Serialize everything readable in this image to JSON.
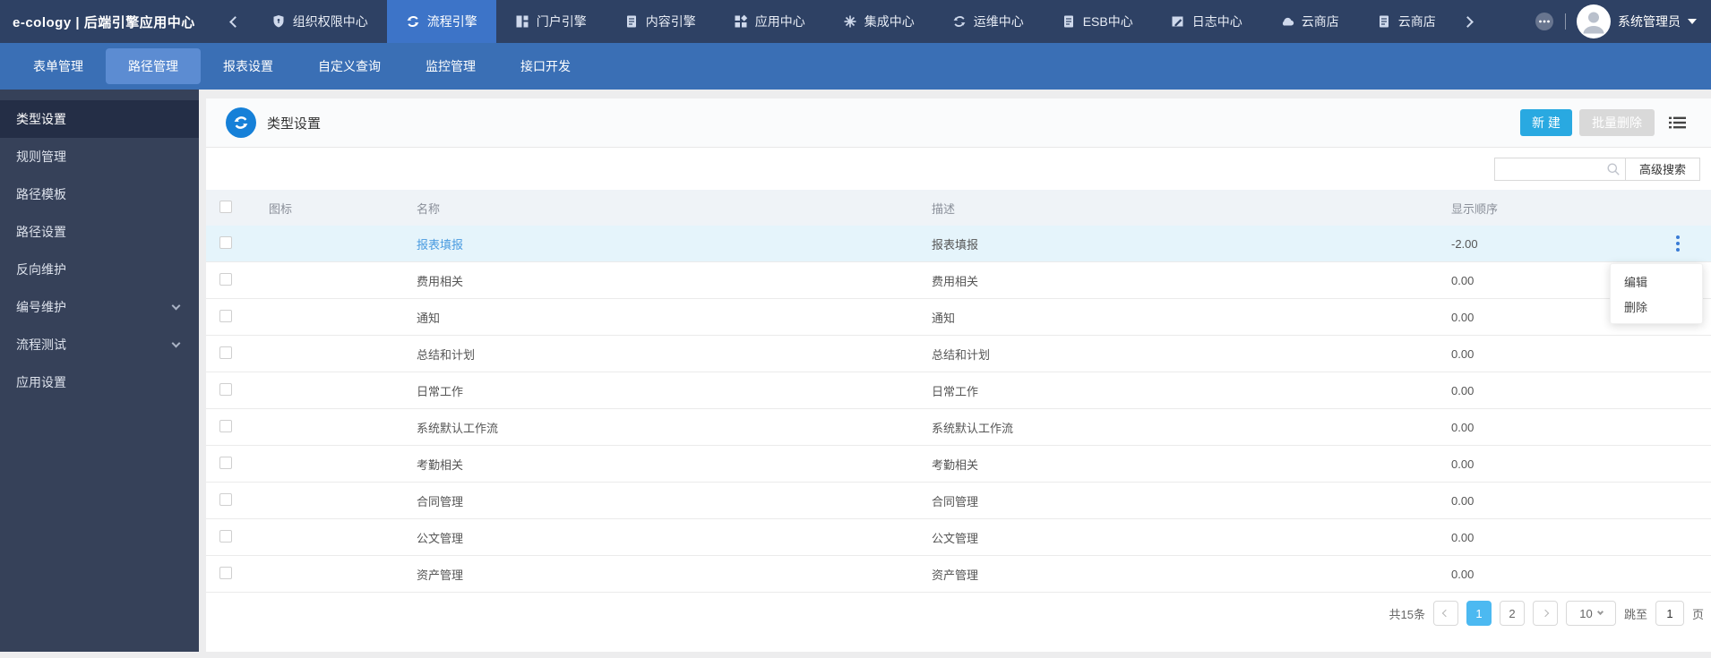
{
  "topbar": {
    "title": "e-cology | 后端引擎应用中心",
    "items": [
      {
        "label": "组织权限中心",
        "icon": "shield-icon",
        "active": false
      },
      {
        "label": "流程引擎",
        "icon": "flow-icon",
        "active": true
      },
      {
        "label": "门户引擎",
        "icon": "portal-icon",
        "active": false
      },
      {
        "label": "内容引擎",
        "icon": "document-icon",
        "active": false
      },
      {
        "label": "应用中心",
        "icon": "apps-icon",
        "active": false
      },
      {
        "label": "集成中心",
        "icon": "integration-icon",
        "active": false
      },
      {
        "label": "运维中心",
        "icon": "sync-icon",
        "active": false
      },
      {
        "label": "ESB中心",
        "icon": "document-icon",
        "active": false
      },
      {
        "label": "日志中心",
        "icon": "log-icon",
        "active": false
      },
      {
        "label": "云商店",
        "icon": "cloud-icon",
        "active": false
      },
      {
        "label": "云商店",
        "icon": "document-icon",
        "active": false
      }
    ],
    "user": {
      "name": "系统管理员"
    }
  },
  "subnav": {
    "items": [
      {
        "label": "表单管理",
        "active": false
      },
      {
        "label": "路径管理",
        "active": true
      },
      {
        "label": "报表设置",
        "active": false
      },
      {
        "label": "自定义查询",
        "active": false
      },
      {
        "label": "监控管理",
        "active": false
      },
      {
        "label": "接口开发",
        "active": false
      }
    ]
  },
  "sidebar": {
    "items": [
      {
        "label": "类型设置",
        "active": true,
        "expandable": false
      },
      {
        "label": "规则管理",
        "active": false,
        "expandable": false
      },
      {
        "label": "路径模板",
        "active": false,
        "expandable": false
      },
      {
        "label": "路径设置",
        "active": false,
        "expandable": false
      },
      {
        "label": "反向维护",
        "active": false,
        "expandable": false
      },
      {
        "label": "编号维护",
        "active": false,
        "expandable": true
      },
      {
        "label": "流程测试",
        "active": false,
        "expandable": true
      },
      {
        "label": "应用设置",
        "active": false,
        "expandable": false
      }
    ]
  },
  "panel": {
    "title": "类型设置",
    "new_button": "新 建",
    "batch_delete_button": "批量删除",
    "advanced_search_button": "高级搜索",
    "search_value": "",
    "table": {
      "columns": [
        "图标",
        "名称",
        "描述",
        "显示顺序"
      ],
      "rows": [
        {
          "icon": "",
          "name": "报表填报",
          "desc": "报表填报",
          "order": "-2.00",
          "highlighted": true
        },
        {
          "icon": "",
          "name": "费用相关",
          "desc": "费用相关",
          "order": "0.00",
          "highlighted": false
        },
        {
          "icon": "",
          "name": "通知",
          "desc": "通知",
          "order": "0.00",
          "highlighted": false
        },
        {
          "icon": "",
          "name": "总结和计划",
          "desc": "总结和计划",
          "order": "0.00",
          "highlighted": false
        },
        {
          "icon": "",
          "name": "日常工作",
          "desc": "日常工作",
          "order": "0.00",
          "highlighted": false
        },
        {
          "icon": "",
          "name": "系统默认工作流",
          "desc": "系统默认工作流",
          "order": "0.00",
          "highlighted": false
        },
        {
          "icon": "",
          "name": "考勤相关",
          "desc": "考勤相关",
          "order": "0.00",
          "highlighted": false
        },
        {
          "icon": "",
          "name": "合同管理",
          "desc": "合同管理",
          "order": "0.00",
          "highlighted": false
        },
        {
          "icon": "",
          "name": "公文管理",
          "desc": "公文管理",
          "order": "0.00",
          "highlighted": false
        },
        {
          "icon": "",
          "name": "资产管理",
          "desc": "资产管理",
          "order": "0.00",
          "highlighted": false
        }
      ]
    },
    "row_menu": {
      "items": [
        "编辑",
        "删除"
      ]
    },
    "pagination": {
      "total": "共15条",
      "pages": [
        "1",
        "2"
      ],
      "current_page": "1",
      "page_size": "10",
      "jump_label": "跳至",
      "jump_value": "1",
      "page_unit": "页"
    }
  },
  "colors": {
    "topbar_bg": "#2e4164",
    "topbar_active_tab": "#3d74c8",
    "subnav_bg": "#3a6fb5",
    "subnav_active_tab": "#5c8cd2",
    "sidebar_bg": "#364159",
    "sidebar_active_item": "#242e46",
    "primary_button": "#29a9e1",
    "link_blue": "#4a9be0",
    "row_highlight": "#e5f4fb",
    "pagination_active": "#4cb9f1",
    "title_badge": "#1680d8"
  }
}
